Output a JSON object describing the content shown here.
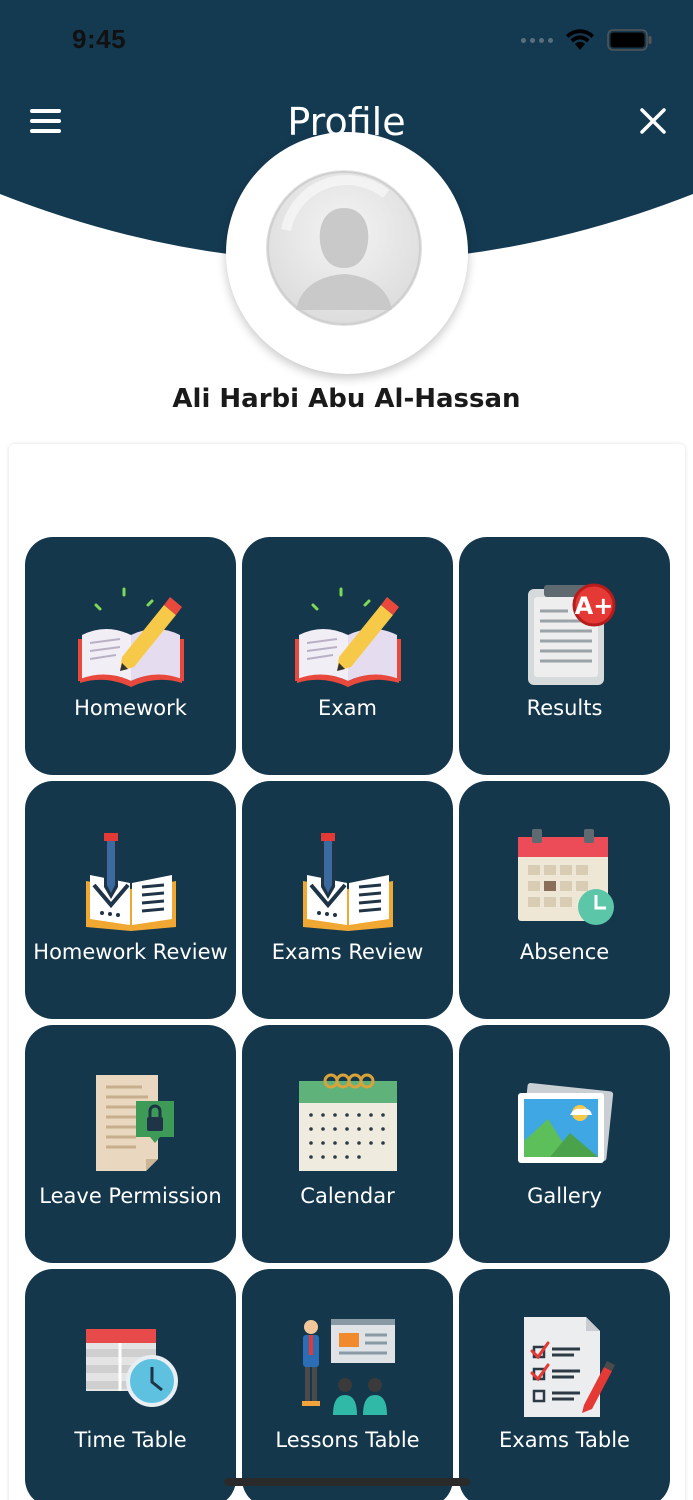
{
  "status_bar": {
    "time": "9:45"
  },
  "header": {
    "title": "Profile",
    "background_color": "#143a52"
  },
  "profile": {
    "name": "Ali Harbi Abu Al-Hassan"
  },
  "tiles": [
    {
      "label": "Homework",
      "icon": "book-pencil-icon"
    },
    {
      "label": "Exam",
      "icon": "book-pencil-icon"
    },
    {
      "label": "Results",
      "icon": "clipboard-grade-icon"
    },
    {
      "label": "Homework Review",
      "icon": "open-book-review-icon"
    },
    {
      "label": "Exams Review",
      "icon": "open-book-review-icon"
    },
    {
      "label": "Absence",
      "icon": "calendar-clock-icon"
    },
    {
      "label": "Leave Permission",
      "icon": "locked-document-icon"
    },
    {
      "label": "Calendar",
      "icon": "calendar-icon"
    },
    {
      "label": "Gallery",
      "icon": "gallery-icon"
    },
    {
      "label": "Time Table",
      "icon": "timetable-clock-icon"
    },
    {
      "label": "Lessons Table",
      "icon": "classroom-icon"
    },
    {
      "label": "Exams Table",
      "icon": "checklist-icon"
    }
  ],
  "colors": {
    "tile_background": "#14374c",
    "accent_red": "#e53935"
  }
}
